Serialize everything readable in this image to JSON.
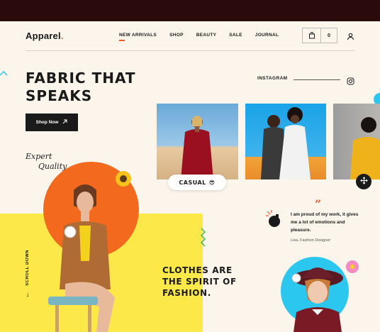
{
  "brand": {
    "name": "Apparel",
    "dot": "."
  },
  "nav": [
    {
      "label": "NEW ARRIVALS",
      "active": true
    },
    {
      "label": "SHOP",
      "active": false
    },
    {
      "label": "BEAUTY",
      "active": false
    },
    {
      "label": "SALE",
      "active": false
    },
    {
      "label": "JOURNAL",
      "active": false
    }
  ],
  "cart": {
    "icon": "shopping-bag-icon",
    "count": "0"
  },
  "hero": {
    "title_line1": "FABRIC THAT",
    "title_line2": "SPEAKS",
    "cta_label": "Shop Now",
    "cta_icon": "arrow-up-right-icon",
    "tagline_line1": "Expert",
    "tagline_line2": "Quality"
  },
  "instagram": {
    "label": "INSTAGRAM",
    "icon": "instagram-icon",
    "badge_label": "CASUAL",
    "badge_emoji": "😎"
  },
  "scroll": {
    "label": "SCROLL DOWN",
    "arrow": "↓"
  },
  "statement": {
    "line1": "CLOTHES ARE",
    "line2": "THE SPIRIT OF",
    "line3": "FASHION."
  },
  "testimonial": {
    "mark": "”",
    "text": "I am proud of my work, it gives me a lot of emotions and pleasure.",
    "author": "Lisa, Fashion Designer"
  },
  "colors": {
    "accent": "#f05a28",
    "yellow": "#fde84a",
    "orange": "#f36a1f",
    "cyan": "#2cc7ef",
    "dark": "#2a0a0a"
  }
}
